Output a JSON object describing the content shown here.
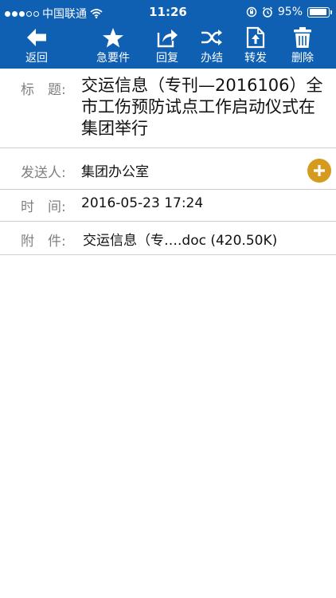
{
  "status_bar": {
    "carrier": "中国联通",
    "time": "11:26",
    "battery": "95%",
    "battery_level": 0.95
  },
  "toolbar": {
    "back_label": "返回",
    "urgent_label": "急要件",
    "reply_label": "回复",
    "complete_label": "办结",
    "forward_label": "转发",
    "delete_label": "删除"
  },
  "message": {
    "subject_label": "标　题:",
    "subject": "交运信息（专刊—2016106）全市工伤预防试点工作启动仪式在集团举行",
    "sender_label": "发送人:",
    "sender": "集团办公室",
    "time_label": "时　间:",
    "time": "2016-05-23 17:24",
    "attachment_label": "附　件:",
    "attachment": "交运信息（专….doc (420.50K)"
  },
  "colors": {
    "header_blue": "#0f5fb3",
    "add_button": "#d49b1e",
    "link_blue": "#1a3fd6"
  },
  "icons": [
    "arrow-left-icon",
    "star-icon",
    "reply-share-icon",
    "shuffle-icon",
    "upload-doc-icon",
    "trash-icon",
    "plus-icon",
    "wifi-icon",
    "lock-rotation-icon",
    "alarm-icon"
  ]
}
